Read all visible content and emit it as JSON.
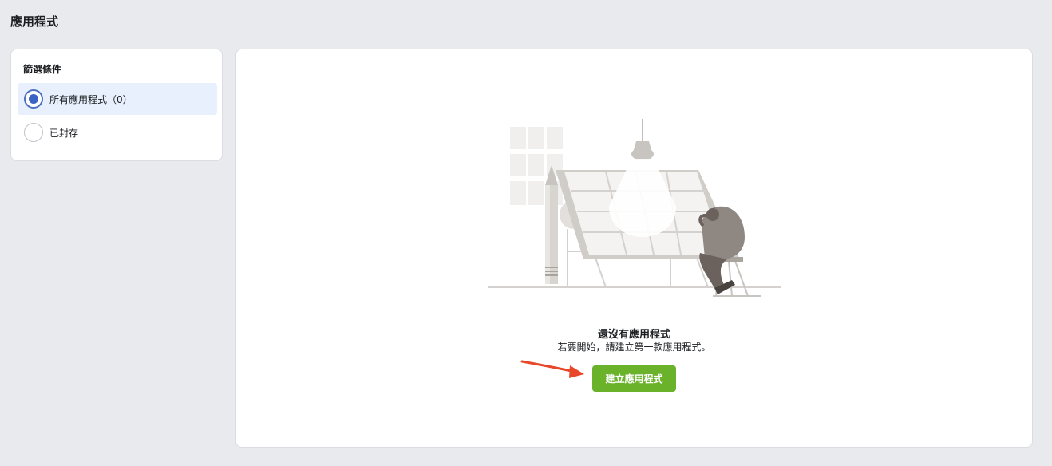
{
  "page": {
    "title": "應用程式"
  },
  "filter": {
    "title": "篩選條件",
    "options": [
      {
        "label": "所有應用程式（0）",
        "selected": true
      },
      {
        "label": "已封存",
        "selected": false
      }
    ]
  },
  "empty_state": {
    "title": "還沒有應用程式",
    "subtitle": "若要開始，請建立第一款應用程式。",
    "create_button_label": "建立應用程式",
    "illustration": "person-at-drafting-table-illustration"
  },
  "colors": {
    "background": "#e9eaed",
    "selected_option_bg": "#e7f0fc",
    "radio_checked": "#3b63c4",
    "create_button": "#69b22a",
    "annotation_arrow": "#e8472a"
  }
}
